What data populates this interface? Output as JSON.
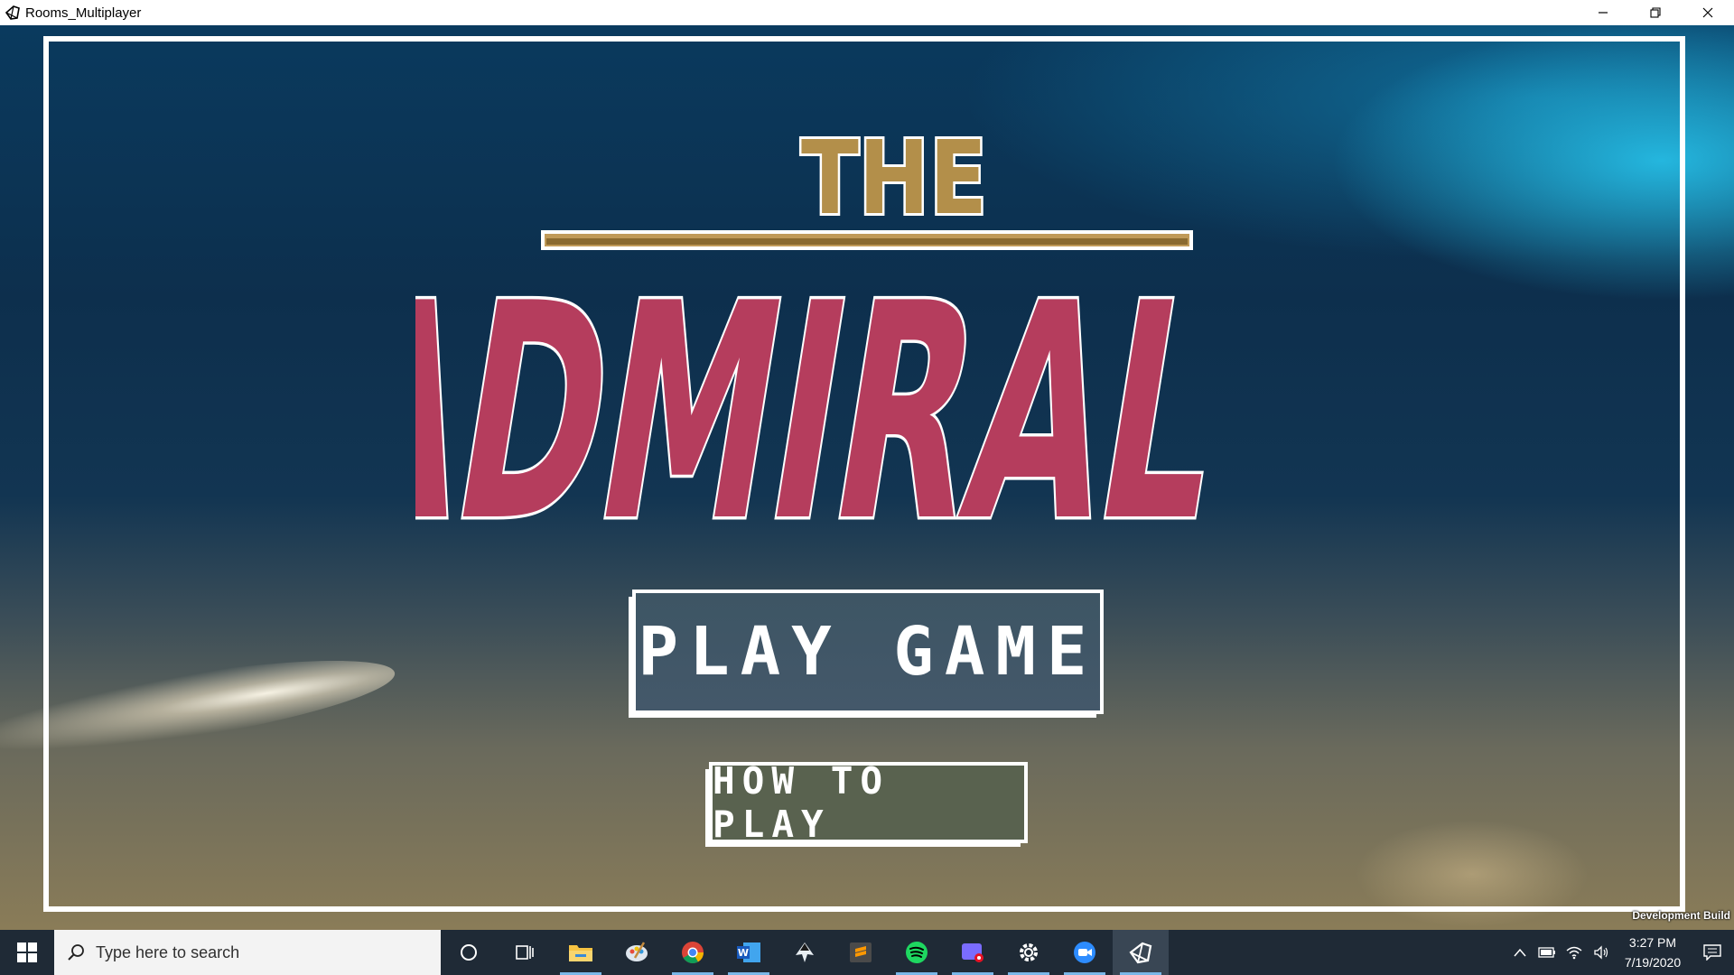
{
  "window": {
    "title": "Rooms_Multiplayer",
    "controls": [
      "minimize",
      "restore",
      "close"
    ]
  },
  "game": {
    "logo": {
      "top_word": "THE",
      "main_word": "ADMIRAL",
      "top_color": "#b38f4a",
      "main_color": "#b53d5d"
    },
    "buttons": {
      "play_game": "PLAY GAME",
      "how_to_play": "HOW TO PLAY"
    },
    "build_label": "Development Build"
  },
  "taskbar": {
    "search_placeholder": "Type here to search",
    "apps": [
      {
        "name": "cortana-icon"
      },
      {
        "name": "task-view-icon"
      },
      {
        "name": "file-explorer-icon",
        "running": true
      },
      {
        "name": "paint-icon"
      },
      {
        "name": "chrome-icon",
        "running": true
      },
      {
        "name": "word-icon",
        "running": true
      },
      {
        "name": "inkscape-icon"
      },
      {
        "name": "sublime-text-icon"
      },
      {
        "name": "spotify-icon",
        "running": true
      },
      {
        "name": "game-bar-icon",
        "running": true
      },
      {
        "name": "settings-icon",
        "running": true
      },
      {
        "name": "zoom-icon",
        "running": true
      },
      {
        "name": "unity-icon",
        "running": true,
        "active": true
      }
    ],
    "clock": {
      "time": "3:27 PM",
      "date": "7/19/2020"
    }
  }
}
